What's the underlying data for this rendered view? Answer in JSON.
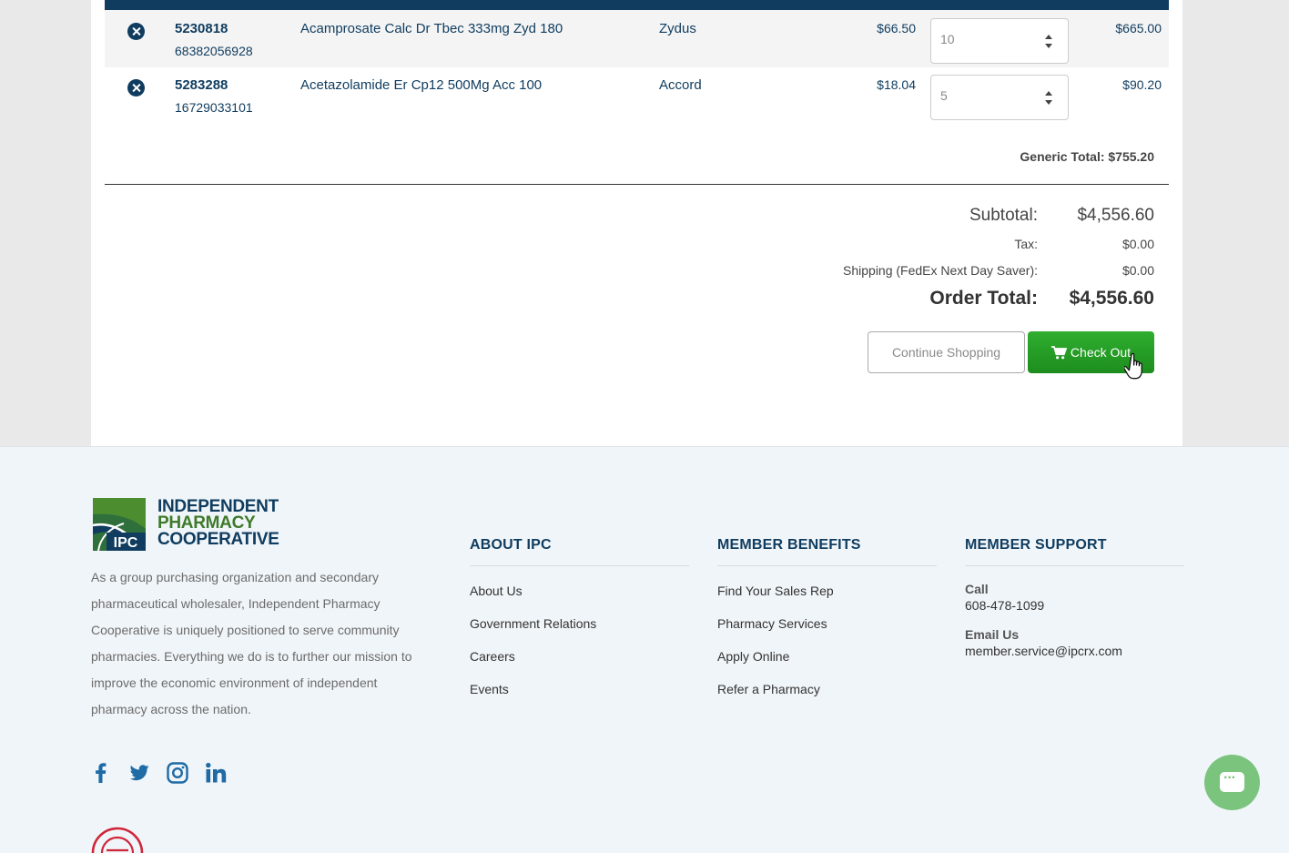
{
  "cart": {
    "items": [
      {
        "item_number": "5230818",
        "ndc": "68382056928",
        "description": "Acamprosate Calc Dr Tbec 333mg Zyd 180",
        "manufacturer": "Zydus",
        "price": "$66.50",
        "quantity": "10",
        "total": "$665.00"
      },
      {
        "item_number": "5283288",
        "ndc": "16729033101",
        "description": "Acetazolamide Er Cp12 500Mg Acc 100",
        "manufacturer": "Accord",
        "price": "$18.04",
        "quantity": "5",
        "total": "$90.20"
      }
    ],
    "generic_total": "Generic Total: $755.20"
  },
  "summary": {
    "subtotal_label": "Subtotal:",
    "subtotal_value": "$4,556.60",
    "tax_label": "Tax:",
    "tax_value": "$0.00",
    "shipping_label": "Shipping (FedEx Next Day Saver):",
    "shipping_value": "$0.00",
    "order_total_label": "Order Total:",
    "order_total_value": "$4,556.60"
  },
  "actions": {
    "continue_label": "Continue Shopping",
    "checkout_label": "Check Out"
  },
  "footer": {
    "logo": {
      "line1": "INDEPENDENT",
      "line2": "PHARMACY",
      "line3": "COOPERATIVE",
      "mark_text": "IPC"
    },
    "about_text": "As a group purchasing organization and secondary pharmaceutical wholesaler, Independent Pharmacy Cooperative is uniquely positioned to serve community pharmacies. Everything we do is to further our mission to improve the economic environment of independent pharmacy across the nation.",
    "social_icons": [
      "facebook-icon",
      "twitter-icon",
      "instagram-icon",
      "linkedin-icon"
    ],
    "columns": {
      "about": {
        "heading": "ABOUT IPC",
        "links": [
          "About Us",
          "Government Relations",
          "Careers",
          "Events"
        ]
      },
      "benefits": {
        "heading": "MEMBER BENEFITS",
        "links": [
          "Find Your Sales Rep",
          "Pharmacy Services",
          "Apply Online",
          "Refer a Pharmacy"
        ]
      },
      "support": {
        "heading": "MEMBER SUPPORT",
        "call_label": "Call",
        "call_value": "608-478-1099",
        "email_label": "Email Us",
        "email_value": "member.service@ipcrx.com"
      }
    }
  },
  "colors": {
    "navy": "#0f3c5f",
    "green": "#23a023",
    "logo_green": "#3f7a2a",
    "chat_green": "#7bc47d",
    "footer_bg": "#f0f5f9",
    "badge_red": "#d0263a"
  }
}
